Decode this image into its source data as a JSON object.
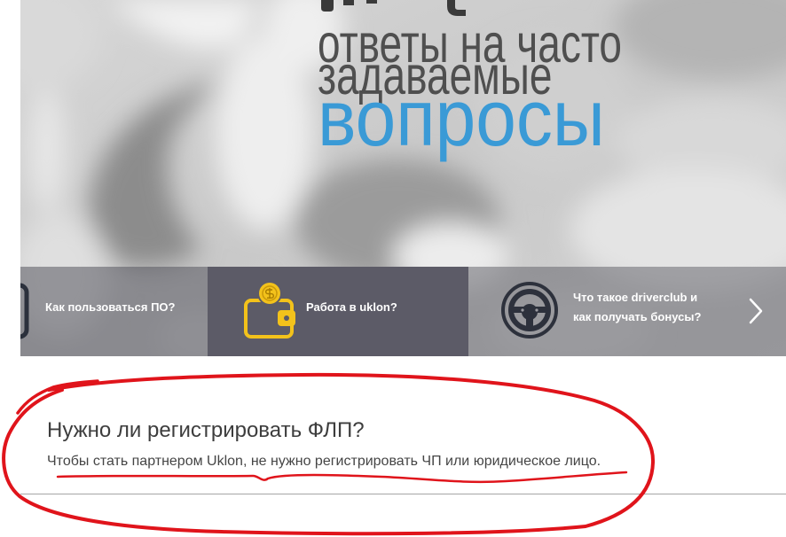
{
  "hero": {
    "title_line1": "ответы на часто",
    "title_line2": "задаваемые",
    "title_line3": "вопросы"
  },
  "tabs": [
    {
      "label": "Как пользоваться ПО?",
      "icon": "device-icon"
    },
    {
      "label": "Работа в uklon?",
      "icon": "wallet-coin-icon",
      "active": true
    },
    {
      "label": "Что такое driverclub и как получать бонусы?",
      "icon": "steering-wheel-icon"
    }
  ],
  "carousel": {
    "next_icon": "chevron-right-icon"
  },
  "faq": {
    "question": "Нужно ли регистрировать ФЛП?",
    "answer": "Чтобы стать партнером Uklon, не нужно регистрировать ЧП или юридическое лицо."
  },
  "colors": {
    "accent_blue": "#3a9ad6",
    "active_tab": "#5c5b67",
    "wallet_yellow": "#f3c21b",
    "annotation_red": "#e0141b"
  }
}
